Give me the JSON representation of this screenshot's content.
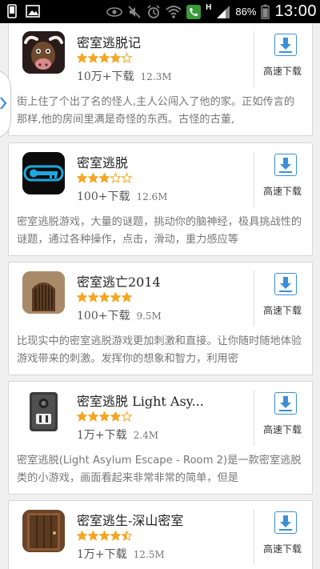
{
  "status_bar": {
    "time": "13:00",
    "battery": "86%",
    "network_letter": "H",
    "icons": [
      "phone-screen-icon",
      "image-icon",
      "eye-icon",
      "mute-icon",
      "alarm-icon",
      "wifi-icon",
      "call-icon",
      "signal-icon",
      "battery-icon"
    ]
  },
  "colors": {
    "star": "#f5a623",
    "download_blue": "#3c8fd6"
  },
  "apps": [
    {
      "title": "密室逃脱记",
      "rating": 4,
      "downloads": "10万+下载",
      "size": "12.3M",
      "action": "高速下载",
      "desc": "街上住了个出了名的怪人,主人公闯入了他的家。正如传言的那样,他的房间里满是奇怪的东西。古怪的古董,",
      "icon": "bull-icon"
    },
    {
      "title": "密室逃脱",
      "rating": 3,
      "downloads": "100+下载",
      "size": "12.6M",
      "action": "高速下载",
      "desc": "密室逃脱游戏，大量的谜题，挑动你的脑神经，极具挑战性的谜题，通过各种操作，点击，滑动，重力感应等",
      "icon": "key-icon"
    },
    {
      "title": "密室逃亡2014",
      "rating": 5,
      "downloads": "100+下载",
      "size": "9.5M",
      "action": "高速下载",
      "desc": "比现实中的密室逃脱游戏更加刺激和直接。让你随时随地体验游戏带来的刺激。发挥你的想象和智力，利用密",
      "icon": "arched-door-icon"
    },
    {
      "title": "密室逃脱 Light Asy...",
      "rating": 4,
      "downloads": "1万+下载",
      "size": "2.4M",
      "action": "高速下载",
      "desc": "密室逃脱(Light Asylum Escape - Room 2)是一款密室逃脱类的小游戏，画面看起来非常非常的简单，但是",
      "icon": "light-switch-icon"
    },
    {
      "title": "密室逃生-深山密室",
      "rating": 4.5,
      "downloads": "1万+下载",
      "size": "12.5M",
      "action": "高速下载",
      "desc": "",
      "icon": "wooden-door-icon"
    }
  ]
}
